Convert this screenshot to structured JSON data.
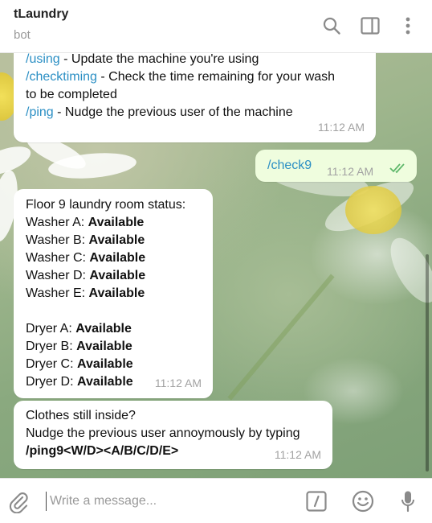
{
  "header": {
    "title": "tLaundry",
    "subtitle": "bot",
    "icons": [
      "search-icon",
      "sidebar-toggle-icon",
      "more-vertical-icon"
    ]
  },
  "messages": {
    "m1": {
      "lines": [
        {
          "cmd": "/using",
          "text": " - Update the machine you're using"
        },
        {
          "cmd": "/checktiming",
          "text": " - Check the time remaining for your wash"
        },
        {
          "cmd": "",
          "text": "to be completed"
        },
        {
          "cmd": "/ping",
          "text": " - Nudge the previous user of the machine"
        }
      ],
      "time": "11:12 AM"
    },
    "m2": {
      "cmd": "/check9",
      "time": "11:12 AM",
      "status_icon": "double-check-icon"
    },
    "m3": {
      "heading": "Floor 9 laundry room status:",
      "washers": [
        {
          "label": "Washer A: ",
          "value": "Available"
        },
        {
          "label": "Washer B: ",
          "value": "Available"
        },
        {
          "label": "Washer C: ",
          "value": "Available"
        },
        {
          "label": "Washer D: ",
          "value": "Available"
        },
        {
          "label": "Washer E: ",
          "value": "Available"
        }
      ],
      "dryers": [
        {
          "label": "Dryer A: ",
          "value": "Available"
        },
        {
          "label": "Dryer B: ",
          "value": "Available"
        },
        {
          "label": "Dryer C: ",
          "value": "Available"
        },
        {
          "label": "Dryer D: ",
          "value": "Available"
        }
      ],
      "time": "11:12 AM"
    },
    "m4": {
      "line1": "Clothes still inside?",
      "line2": "Nudge the previous user annoymously by typing",
      "line3": "/ping9<W/D><A/B/C/D/E>",
      "time": "11:12 AM"
    }
  },
  "input": {
    "placeholder": "Write a message...",
    "value": "",
    "icons": [
      "paperclip-icon",
      "bot-command-icon",
      "emoji-icon",
      "microphone-icon"
    ]
  },
  "colors": {
    "link": "#2b8fc4",
    "outgoing_bubble": "#effdde",
    "check": "#5fb86b",
    "icon_gray": "#8a8a8a"
  }
}
